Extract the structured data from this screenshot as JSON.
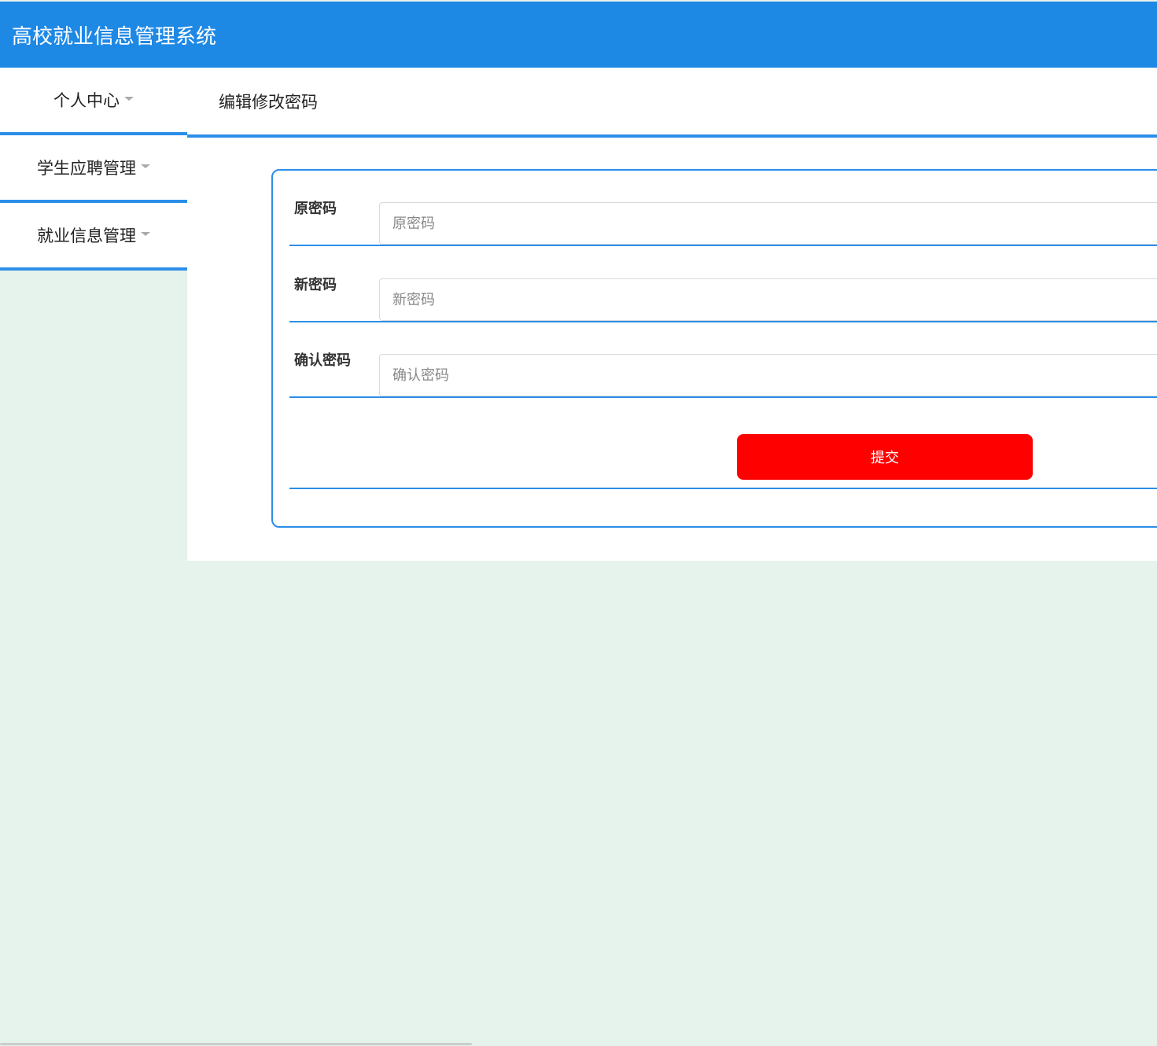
{
  "app": {
    "title": "高校就业信息管理系统"
  },
  "sidebar": {
    "items": [
      {
        "label": "个人中心"
      },
      {
        "label": "学生应聘管理"
      },
      {
        "label": "就业信息管理"
      }
    ]
  },
  "page": {
    "title": "编辑修改密码"
  },
  "form": {
    "old_password": {
      "label": "原密码",
      "placeholder": "原密码",
      "value": ""
    },
    "new_password": {
      "label": "新密码",
      "placeholder": "新密码",
      "value": ""
    },
    "confirm_password": {
      "label": "确认密码",
      "placeholder": "确认密码",
      "value": ""
    },
    "submit_label": "提交"
  },
  "colors": {
    "header_bg": "#1e88e5",
    "accent_border": "#2b8ee8",
    "submit_bg": "#ff0000",
    "page_bg": "#e6f2ec"
  },
  "icons": {
    "dropdown": "caret-down-icon"
  }
}
